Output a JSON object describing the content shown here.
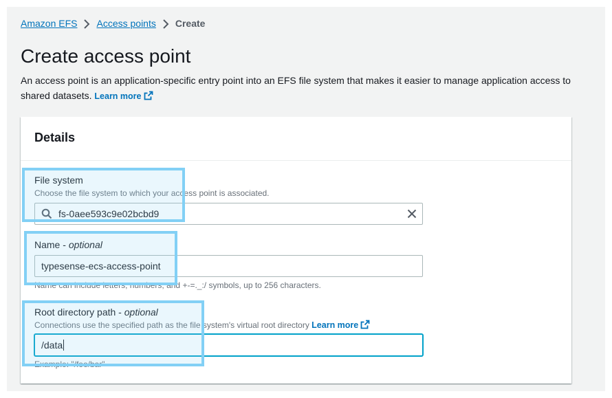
{
  "breadcrumb": {
    "items": [
      "Amazon EFS",
      "Access points"
    ],
    "current": "Create"
  },
  "header": {
    "title": "Create access point",
    "description": "An access point is an application-specific entry point into an EFS file system that makes it easier to manage application access to shared datasets.",
    "learn_more": "Learn more"
  },
  "details": {
    "title": "Details",
    "file_system": {
      "label": "File system",
      "description": "Choose the file system to which your access point is associated.",
      "value": "fs-0aee593c9e02bcbd9"
    },
    "name": {
      "label": "Name",
      "optional": "optional",
      "value": "typesense-ecs-access-point",
      "constraint": "Name can include letters, numbers, and +-=._:/ symbols, up to 256 characters."
    },
    "root_directory": {
      "label": "Root directory path",
      "optional": "optional",
      "description": "Connections use the specified path as the file system's virtual root directory",
      "learn_more": "Learn more",
      "value": "/data",
      "example": "Example: \"/foo/bar\""
    }
  },
  "colors": {
    "link": "#0073bb",
    "highlight": "#82d0f5",
    "focus": "#00a1c9"
  }
}
